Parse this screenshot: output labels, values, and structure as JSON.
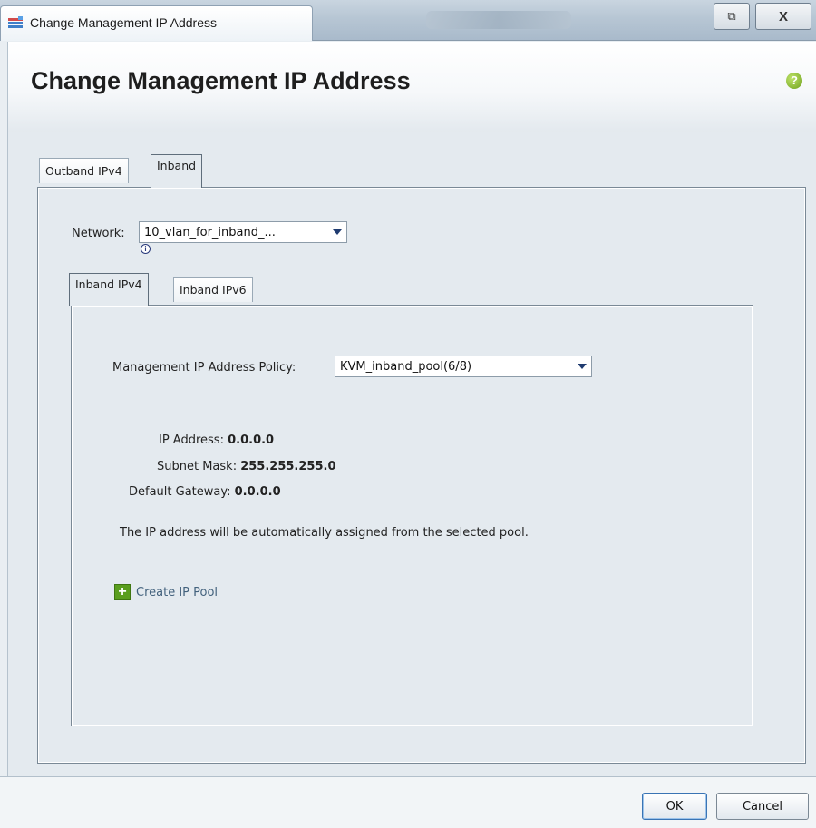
{
  "window": {
    "title": "Change Management IP Address",
    "restore_glyph": "⧉",
    "close_glyph": "X"
  },
  "header": {
    "title": "Change Management IP Address",
    "help_glyph": "?"
  },
  "tabs": {
    "outer": [
      {
        "label": "Outband IPv4",
        "active": false
      },
      {
        "label": "Inband",
        "active": true
      }
    ],
    "inner": [
      {
        "label": "Inband IPv4",
        "active": true
      },
      {
        "label": "Inband IPv6",
        "active": false
      }
    ]
  },
  "network": {
    "label": "Network:",
    "value": "10_vlan_for_inband_...",
    "info_glyph": "i"
  },
  "policy": {
    "label": "Management IP Address Policy:",
    "value": "KVM_inband_pool(6/8)"
  },
  "details": {
    "ip_label": "IP Address:",
    "ip_value": "0.0.0.0",
    "mask_label": "Subnet Mask:",
    "mask_value": "255.255.255.0",
    "gateway_label": "Default Gateway:",
    "gateway_value": "0.0.0.0",
    "note": "The IP address will be automatically assigned from the selected pool."
  },
  "create_pool": {
    "label": "Create IP Pool",
    "icon_glyph": "+"
  },
  "footer": {
    "ok_label": "OK",
    "cancel_label": "Cancel"
  },
  "colors": {
    "accent_green": "#5a9e1e",
    "link": "#43627d",
    "panel_bg": "#e4eaef"
  }
}
